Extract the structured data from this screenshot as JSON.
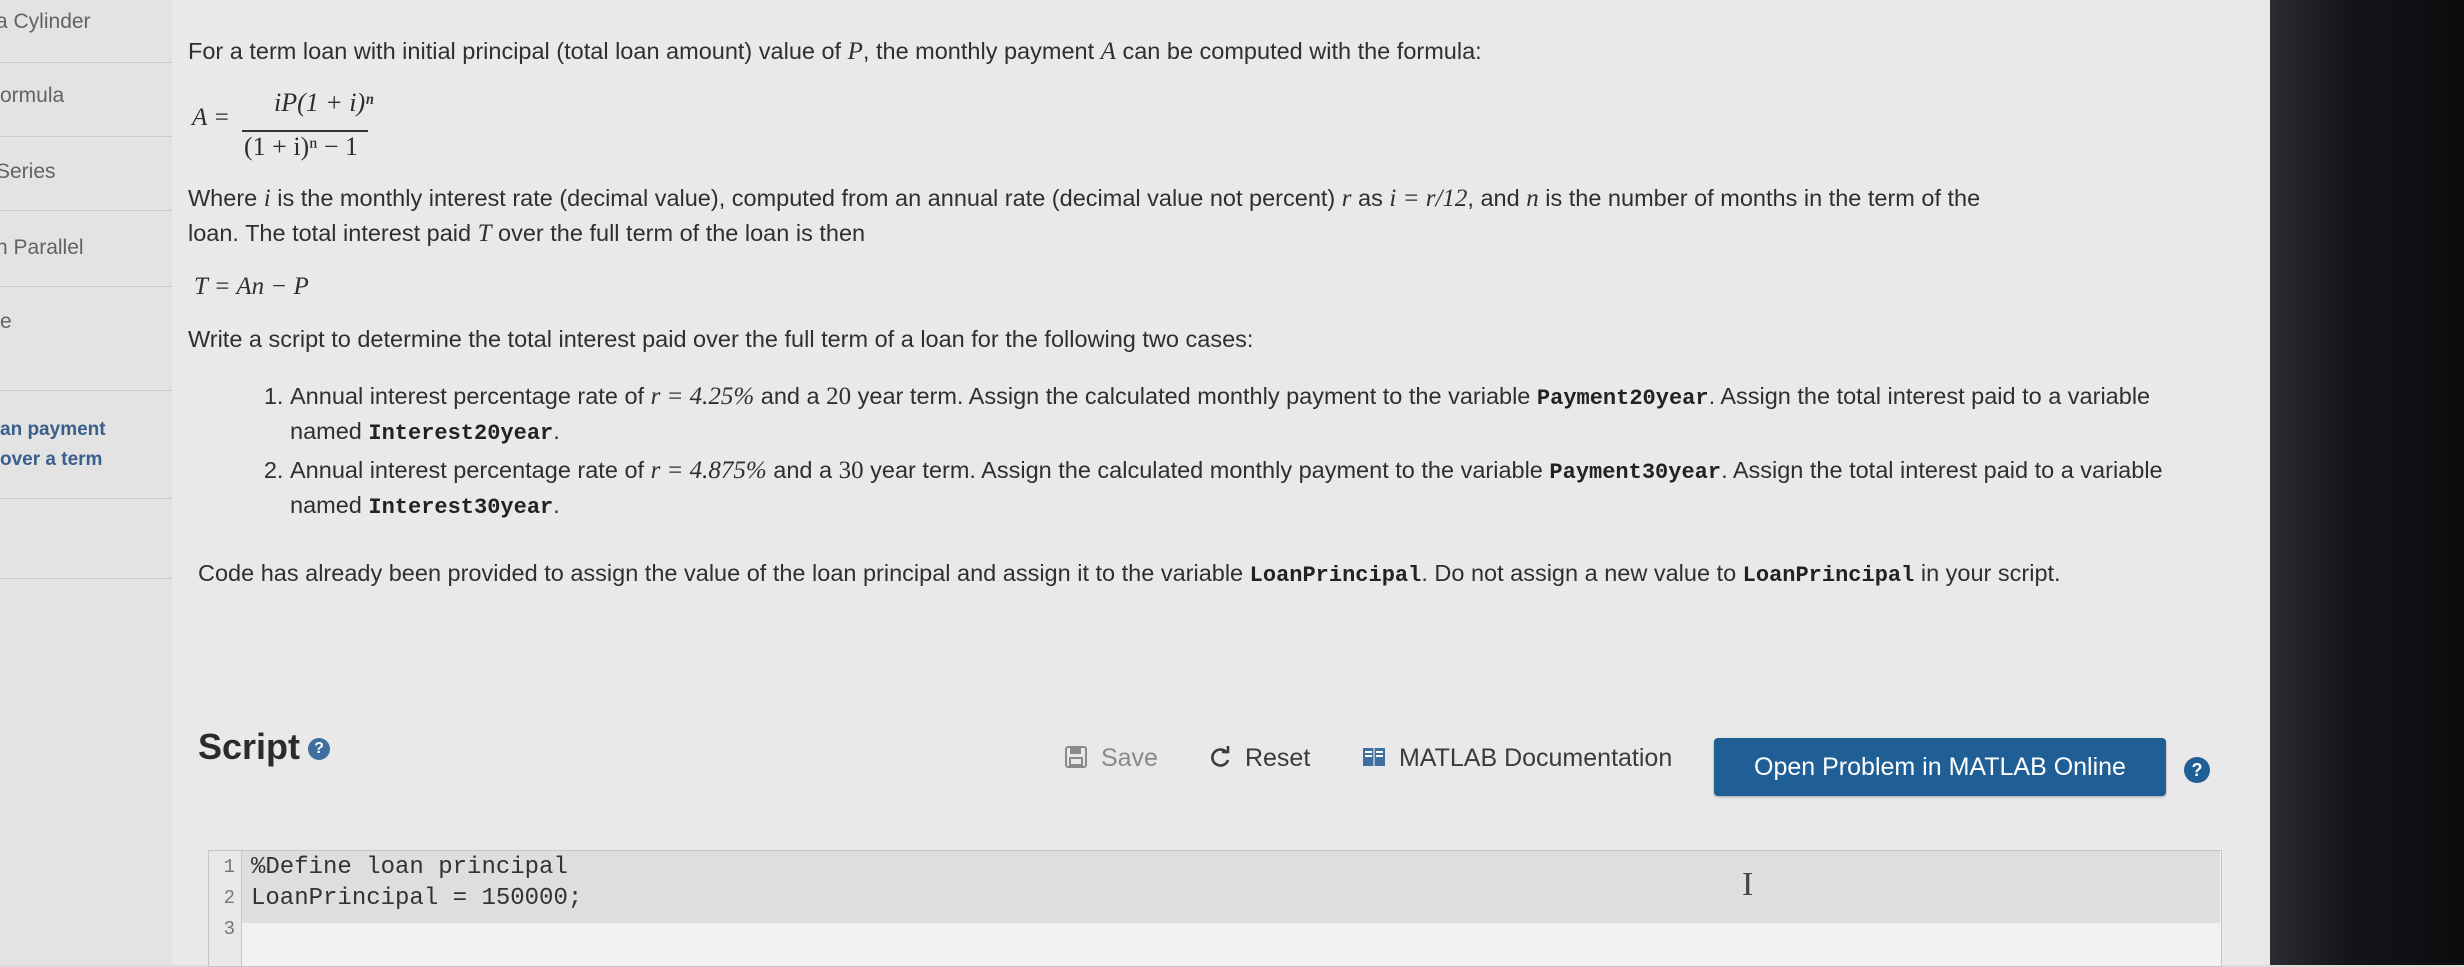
{
  "sidebar": {
    "items": [
      {
        "label": "a Cylinder"
      },
      {
        "label": "ormula"
      },
      {
        "label": "Series"
      },
      {
        "label": "n Parallel"
      },
      {
        "label": "e"
      },
      {
        "label": "an payment"
      },
      {
        "label": "over a term"
      }
    ]
  },
  "problem": {
    "intro": [
      "For a term loan with initial principal (total loan amount) value of ",
      "P",
      ", the monthly payment ",
      "A",
      " can be computed with the formula:"
    ],
    "formula1": {
      "lhs": "A =",
      "num": "iP(1 + i)ⁿ",
      "den": "(1 + i)ⁿ − 1"
    },
    "where": {
      "t1": "Where ",
      "i": "i",
      "t2": " is the monthly interest rate (decimal value), computed from an annual rate (decimal value not percent) ",
      "r": "r",
      "t3": " as ",
      "expr": "i = r/12",
      "t4": ", and ",
      "n": "n",
      "t5": " is the number of months in the term of the",
      "line2a": "loan. The total interest paid ",
      "T": "T",
      "line2b": " over the full term of the loan is then"
    },
    "formula2": "T = An − P",
    "task": "Write a script to determine the total interest paid over the full term of a loan for the following two cases:",
    "cases": [
      {
        "a": "Annual interest percentage rate of ",
        "rate": "r = 4.25%",
        "b": " and a ",
        "years": "20",
        "c": " year term. Assign the calculated monthly payment to the variable ",
        "var1": "Payment20year",
        "d": ". Assign the total interest paid to a variable named ",
        "var2": "Interest20year",
        "e": "."
      },
      {
        "a": "Annual interest percentage rate of ",
        "rate": "r = 4.875%",
        "b": " and a ",
        "years": "30",
        "c": " year term. Assign the calculated monthly payment to the variable ",
        "var1": "Payment30year",
        "d": ". Assign the total interest paid to a variable named ",
        "var2": "Interest30year",
        "e": "."
      }
    ],
    "note": {
      "a": "Code has already been provided to assign the value of the loan principal and assign it to the variable ",
      "v1": "LoanPrincipal",
      "b": ". Do not assign a new value to ",
      "v2": "LoanPrincipal",
      "c": " in your script."
    }
  },
  "script": {
    "title": "Script",
    "help": "?",
    "toolbar": {
      "save": "Save",
      "reset": "Reset",
      "docs": "MATLAB Documentation",
      "open": "Open Problem in MATLAB Online",
      "help": "?"
    },
    "editor": {
      "lines": [
        {
          "n": "1",
          "code": "%Define loan principal"
        },
        {
          "n": "2",
          "code": "LoanPrincipal = 150000;"
        },
        {
          "n": "3",
          "code": ""
        }
      ]
    }
  },
  "icons": {
    "save": "floppy-disk-icon",
    "reset": "refresh-icon",
    "docs": "book-icon",
    "cursor": "text-cursor-icon"
  },
  "colors": {
    "primary_button": "#1f5f96",
    "sidebar_link": "#3a5f8c"
  }
}
